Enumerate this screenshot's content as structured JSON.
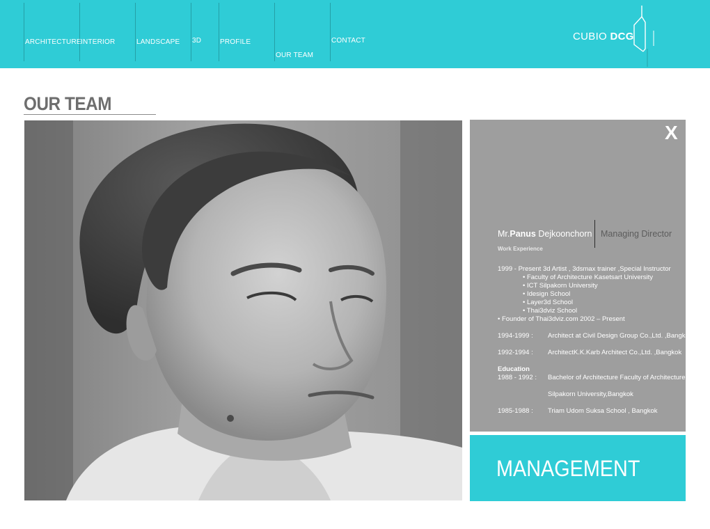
{
  "nav": {
    "items": [
      {
        "label": "ARCHITECTURE"
      },
      {
        "label": "INTERIOR"
      },
      {
        "label": "LANDSCAPE"
      },
      {
        "label": "3D"
      },
      {
        "label": "PROFILE"
      },
      {
        "label": "OUR TEAM"
      },
      {
        "label": "CONTACT"
      }
    ]
  },
  "logo": {
    "text_light": "CUBIO ",
    "text_bold": "DCG"
  },
  "page": {
    "title": "OUR TEAM"
  },
  "person": {
    "prefix": "Mr.",
    "first_name": "Panus",
    "last_name": " Dejkoonchorn",
    "position": "Managing Director",
    "work_label": "Work Experience",
    "close_label": "X",
    "cv_lines": [
      "1999 - Present  3d Artist , 3dsmax trainer ,Special Instructor",
      "• Faculty of Architecture Kasetsart University",
      "• ICT Silpakorn University",
      "• Idesign School",
      "• Layer3d School",
      "• Thai3dviz School",
      "• Founder of Thai3dviz.com 2002 – Present",
      "1994-1999  :",
      "Architect at Civil Design Group Co.,Ltd. ,Bangkok",
      "1992-1994  :",
      "ArchitectK.K.Karb Architect Co.,Ltd. ,Bangkok",
      "Education",
      "1988 - 1992 :",
      "Bachelor of Architecture Faculty of Architecture",
      "Silpakorn University,Bangkok",
      "1985-1988 :",
      "Triam Udom Suksa School , Bangkok"
    ]
  },
  "section": {
    "label": "MANAGEMENT"
  },
  "colors": {
    "accent": "#2fccd6",
    "panel": "#9e9e9e",
    "title": "#6e6e6e"
  }
}
